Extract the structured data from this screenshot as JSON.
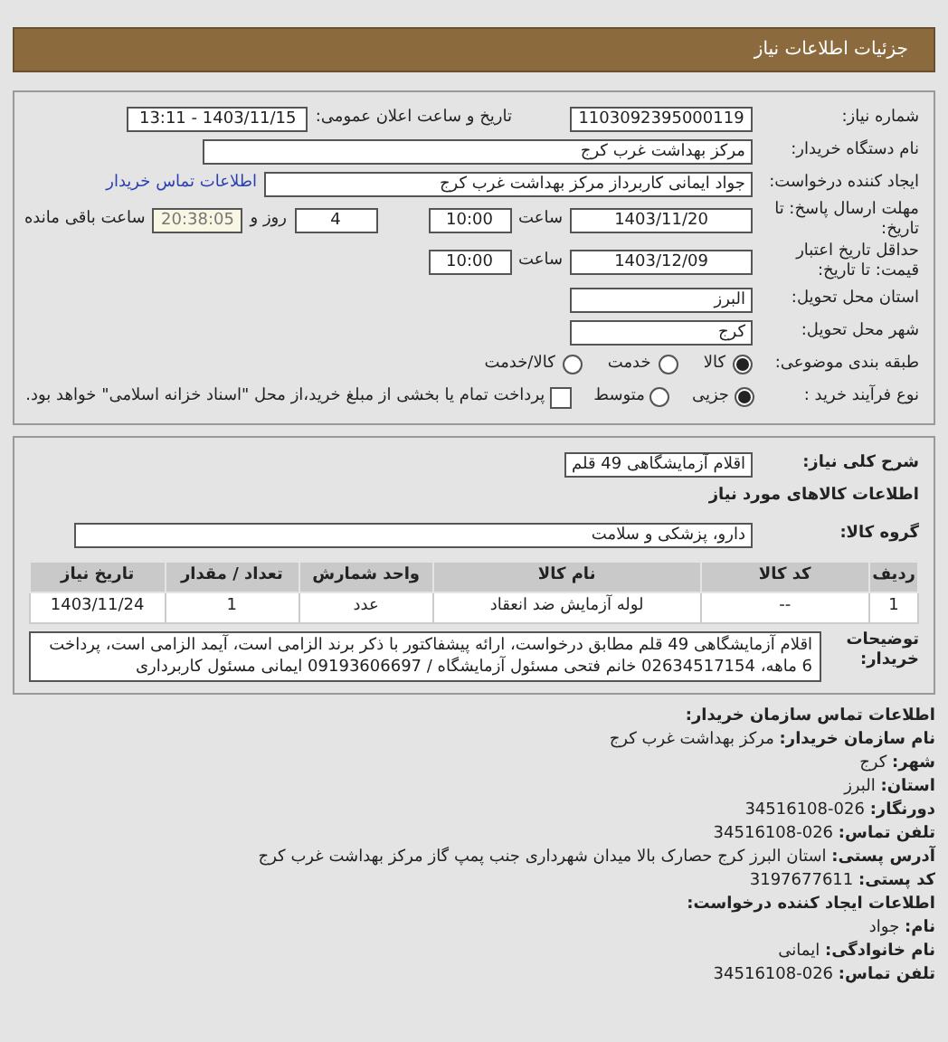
{
  "header": {
    "title": "جزئیات اطلاعات نیاز"
  },
  "need_number": {
    "label": "شماره نیاز:",
    "value": "1103092395000119"
  },
  "announce": {
    "label": "تاریخ و ساعت اعلان عمومی:",
    "value": "1403/11/15 - 13:11"
  },
  "buyer": {
    "label": "نام دستگاه خریدار:",
    "value": "مرکز بهداشت غرب کرج"
  },
  "creator": {
    "label": "ایجاد کننده درخواست:",
    "value": "جواد ایمانی کاربرداز مرکز بهداشت غرب کرج",
    "link": "اطلاعات تماس خریدار"
  },
  "deadline": {
    "label": "مهلت ارسال پاسخ: تا تاریخ:",
    "date": "1403/11/20",
    "time_label": "ساعت",
    "time": "10:00",
    "days": "4",
    "days_label": "روز و",
    "remaining": "20:38:05",
    "remaining_label": "ساعت باقی مانده"
  },
  "validity": {
    "label": "حداقل تاریخ اعتبار قیمت: تا تاریخ:",
    "date": "1403/12/09",
    "time_label": "ساعت",
    "time": "10:00"
  },
  "province": {
    "label": "استان محل تحویل:",
    "value": "البرز"
  },
  "city": {
    "label": "شهر محل تحویل:",
    "value": "کرج"
  },
  "category": {
    "label": "طبقه بندی موضوعی:",
    "options": [
      {
        "label": "کالا",
        "selected": true
      },
      {
        "label": "خدمت",
        "selected": false
      },
      {
        "label": "کالا/خدمت",
        "selected": false
      }
    ]
  },
  "process": {
    "label": "نوع فرآیند خرید :",
    "options": [
      {
        "label": "جزیی",
        "selected": true
      },
      {
        "label": "متوسط",
        "selected": false
      }
    ],
    "treasury": {
      "label": "پرداخت تمام یا بخشی از مبلغ خرید،از محل \"اسناد خزانه اسلامی\" خواهد بود.",
      "checked": false
    }
  },
  "summary": {
    "label": "شرح کلی نیاز:",
    "value": "اقلام آزمایشگاهی 49 قلم"
  },
  "goods_heading": "اطلاعات کالاهای مورد نیاز",
  "goods_group": {
    "label": "گروه کالا:",
    "value": "دارو، پزشکی و سلامت"
  },
  "table": {
    "columns": [
      "ردیف",
      "کد کالا",
      "نام کالا",
      "واحد شمارش",
      "تعداد / مقدار",
      "تاریخ نیاز"
    ],
    "rows": [
      [
        "1",
        "--",
        "لوله آزمایش ضد انعقاد",
        "عدد",
        "1",
        "1403/11/24"
      ]
    ]
  },
  "notes": {
    "label": "توضیحات خریدار:",
    "text": "اقلام آزمایشگاهی 49 قلم مطابق درخواست، ارائه پیشفاکتور با ذکر برند الزامی است، آیمد الزامی است، پرداخت 6 ماهه، 02634517154 خانم فتحی مسئول آزمایشگاه / 09193606697 ایمانی مسئول کاربرداری"
  },
  "contact_sections": [
    {
      "heading": "اطلاعات تماس سازمان خریدار:",
      "lines": [
        {
          "label": "نام سازمان خریدار:",
          "value": "مرکز بهداشت غرب کرج"
        },
        {
          "label": "شهر:",
          "value": "کرج"
        },
        {
          "label": "استان:",
          "value": "البرز"
        },
        {
          "label": "دورنگار:",
          "value": "026-34516108"
        },
        {
          "label": "تلفن تماس:",
          "value": "026-34516108"
        },
        {
          "label": "آدرس پستی:",
          "value": "استان البرز کرج حصارک بالا میدان شهرداری جنب پمپ گاز مرکز بهداشت غرب کرج"
        },
        {
          "label": "کد پستی:",
          "value": "3197677611"
        }
      ]
    },
    {
      "heading": "اطلاعات ایجاد کننده درخواست:",
      "lines": [
        {
          "label": "نام:",
          "value": "جواد"
        },
        {
          "label": "نام خانوادگی:",
          "value": "ایمانی"
        },
        {
          "label": "تلفن تماس:",
          "value": "026-34516108"
        }
      ]
    }
  ]
}
